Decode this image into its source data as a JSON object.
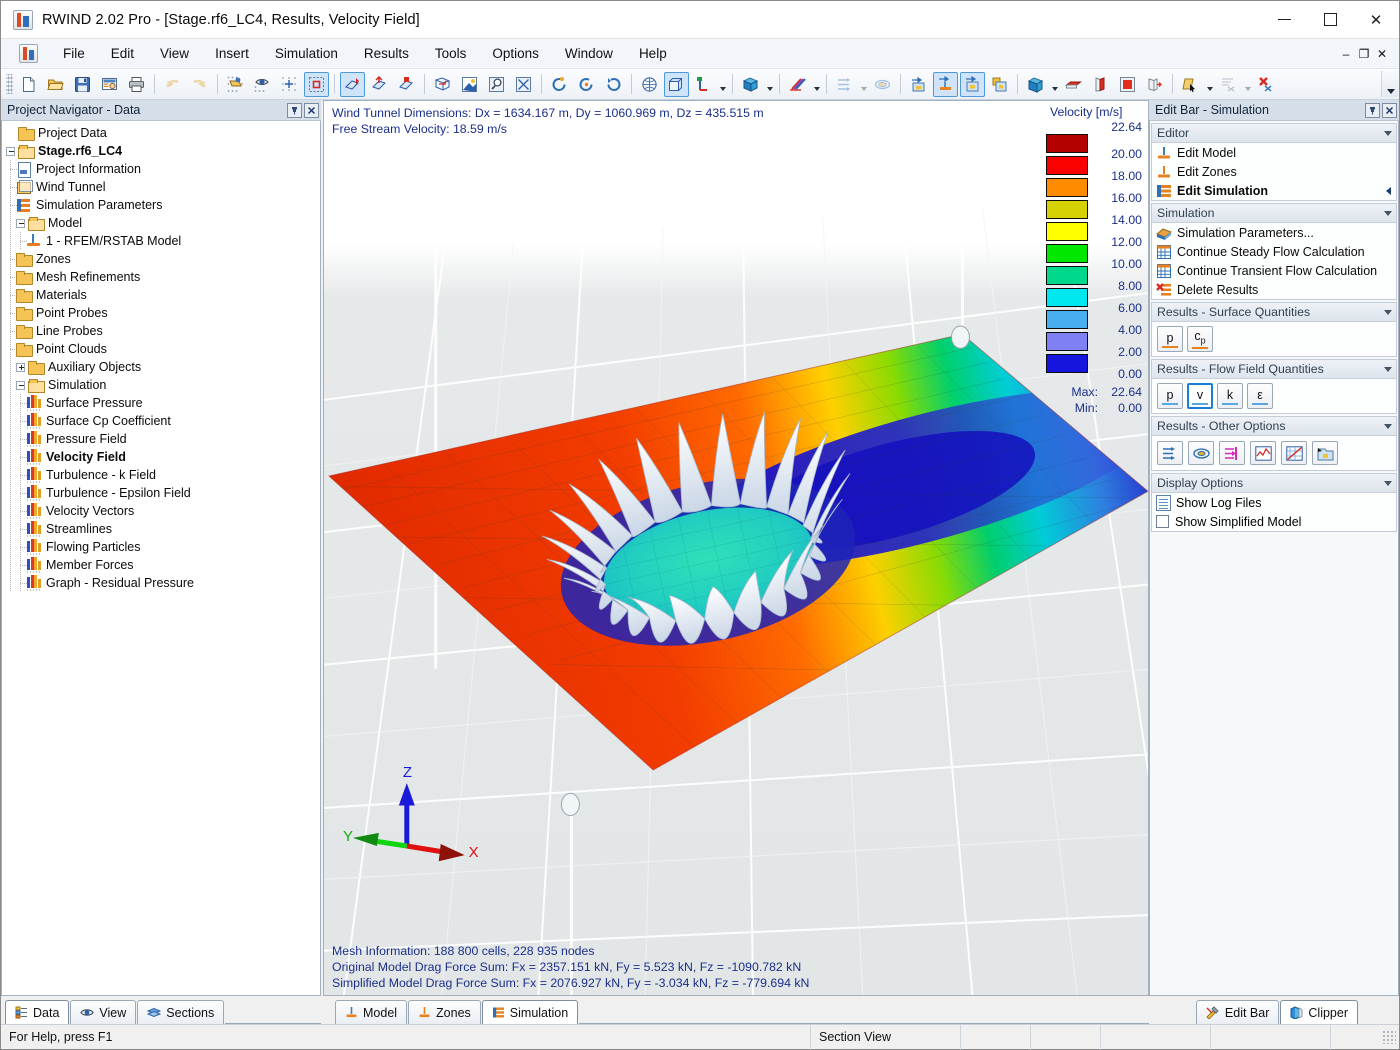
{
  "window": {
    "title": "RWIND 2.02 Pro - [Stage.rf6_LC4, Results, Velocity Field]",
    "app_icon": "rwind-icon",
    "minimize": "–",
    "maximize": "☐",
    "close": "✕"
  },
  "mdi_buttons": {
    "minimize": "–",
    "restore": "❐",
    "close": "✕"
  },
  "menu": {
    "items": [
      {
        "label": "File"
      },
      {
        "label": "Edit"
      },
      {
        "label": "View"
      },
      {
        "label": "Insert"
      },
      {
        "label": "Simulation"
      },
      {
        "label": "Results"
      },
      {
        "label": "Tools"
      },
      {
        "label": "Options"
      },
      {
        "label": "Window"
      },
      {
        "label": "Help"
      }
    ]
  },
  "toolbar": {
    "groups": [
      {
        "buttons": [
          {
            "name": "new-file-icon",
            "state": "normal"
          },
          {
            "name": "open-file-icon",
            "state": "normal"
          },
          {
            "name": "save-icon",
            "state": "normal"
          },
          {
            "name": "project-info-icon",
            "state": "normal"
          },
          {
            "name": "print-icon",
            "state": "normal"
          }
        ]
      },
      {
        "buttons": [
          {
            "name": "undo-icon",
            "state": "disabled"
          },
          {
            "name": "redo-icon",
            "state": "disabled"
          }
        ]
      },
      {
        "buttons": [
          {
            "name": "select-all-icon",
            "state": "normal"
          },
          {
            "name": "select-visible-icon",
            "state": "normal"
          },
          {
            "name": "snap-grid-icon",
            "state": "normal"
          },
          {
            "name": "selection-box-icon",
            "state": "active"
          }
        ]
      },
      {
        "buttons": [
          {
            "name": "move-object-icon",
            "state": "active"
          },
          {
            "name": "rotate-object-icon",
            "state": "normal"
          },
          {
            "name": "scale-object-icon",
            "state": "normal"
          }
        ]
      },
      {
        "buttons": [
          {
            "name": "wireframe-view-icon",
            "state": "normal"
          },
          {
            "name": "render-view-icon",
            "state": "normal"
          },
          {
            "name": "zoom-window-icon",
            "state": "normal"
          },
          {
            "name": "zoom-area-icon",
            "state": "normal"
          },
          {
            "name": "zoom-fit-icon",
            "state": "normal"
          }
        ]
      },
      {
        "buttons": [
          {
            "name": "rotate-view-icon",
            "state": "normal"
          },
          {
            "name": "rotate-ccw-icon",
            "state": "normal"
          },
          {
            "name": "rotate-cw-icon",
            "state": "normal"
          }
        ]
      },
      {
        "buttons": [
          {
            "name": "isometric-view-icon",
            "state": "normal"
          },
          {
            "name": "perspective-view-icon",
            "state": "active"
          },
          {
            "name": "axis-view-icon",
            "state": "dropdown"
          }
        ]
      },
      {
        "buttons": [
          {
            "name": "render-mode-icon",
            "state": "dropdown"
          }
        ]
      },
      {
        "buttons": [
          {
            "name": "color-scale-icon",
            "state": "dropdown"
          }
        ]
      },
      {
        "buttons": [
          {
            "name": "flow-arrows-icon",
            "state": "dropdown-disabled"
          },
          {
            "name": "streamlines-icon",
            "state": "disabled"
          }
        ]
      },
      {
        "buttons": [
          {
            "name": "result-surface-icon",
            "state": "normal"
          },
          {
            "name": "result-model-icon",
            "state": "active"
          },
          {
            "name": "result-section-icon",
            "state": "active"
          },
          {
            "name": "result-texture-icon",
            "state": "normal"
          }
        ]
      },
      {
        "buttons": [
          {
            "name": "clip-box-icon",
            "state": "dropdown"
          },
          {
            "name": "clip-plane-x-icon",
            "state": "normal"
          },
          {
            "name": "clip-plane-y-icon",
            "state": "normal"
          },
          {
            "name": "clip-plane-z-icon",
            "state": "normal"
          },
          {
            "name": "clip-move-icon",
            "state": "normal"
          }
        ]
      },
      {
        "buttons": [
          {
            "name": "pick-section-icon",
            "state": "dropdown"
          },
          {
            "name": "cut-section-icon",
            "state": "dropdown-disabled"
          },
          {
            "name": "delete-section-icon",
            "state": "normal"
          }
        ]
      }
    ]
  },
  "navigator": {
    "title": "Project Navigator - Data",
    "pin_glyph": "Π",
    "close_glyph": "✕",
    "tree": [
      {
        "label": "Project Data",
        "depth": 0,
        "icon": "folder",
        "toggle": "none",
        "bold": false
      },
      {
        "label": "Stage.rf6_LC4",
        "depth": 0,
        "icon": "folderopen",
        "toggle": "minus",
        "bold": true
      },
      {
        "label": "Project Information",
        "depth": 1,
        "icon": "doc",
        "toggle": "none",
        "bold": false
      },
      {
        "label": "Wind Tunnel",
        "depth": 1,
        "icon": "cube",
        "toggle": "none",
        "bold": false
      },
      {
        "label": "Simulation Parameters",
        "depth": 1,
        "icon": "simparams",
        "toggle": "none",
        "bold": false
      },
      {
        "label": "Model",
        "depth": 1,
        "icon": "folderopen",
        "toggle": "minus",
        "bold": false
      },
      {
        "label": "1 - RFEM/RSTAB Model",
        "depth": 2,
        "icon": "model",
        "toggle": "none",
        "bold": false
      },
      {
        "label": "Zones",
        "depth": 1,
        "icon": "folder",
        "toggle": "none",
        "bold": false
      },
      {
        "label": "Mesh Refinements",
        "depth": 1,
        "icon": "folder",
        "toggle": "none",
        "bold": false
      },
      {
        "label": "Materials",
        "depth": 1,
        "icon": "folder",
        "toggle": "none",
        "bold": false
      },
      {
        "label": "Point Probes",
        "depth": 1,
        "icon": "folder",
        "toggle": "none",
        "bold": false
      },
      {
        "label": "Line Probes",
        "depth": 1,
        "icon": "folder",
        "toggle": "none",
        "bold": false
      },
      {
        "label": "Point Clouds",
        "depth": 1,
        "icon": "folder",
        "toggle": "none",
        "bold": false
      },
      {
        "label": "Auxiliary Objects",
        "depth": 1,
        "icon": "folder",
        "toggle": "plus",
        "bold": false
      },
      {
        "label": "Simulation",
        "depth": 1,
        "icon": "folderopen",
        "toggle": "minus",
        "bold": false
      },
      {
        "label": "Surface Pressure",
        "depth": 2,
        "icon": "result",
        "toggle": "none",
        "bold": false
      },
      {
        "label": "Surface Cp Coefficient",
        "depth": 2,
        "icon": "result",
        "toggle": "none",
        "bold": false
      },
      {
        "label": "Pressure Field",
        "depth": 2,
        "icon": "result",
        "toggle": "none",
        "bold": false
      },
      {
        "label": "Velocity Field",
        "depth": 2,
        "icon": "result",
        "toggle": "none",
        "bold": true
      },
      {
        "label": "Turbulence - k Field",
        "depth": 2,
        "icon": "result",
        "toggle": "none",
        "bold": false
      },
      {
        "label": "Turbulence - Epsilon Field",
        "depth": 2,
        "icon": "result",
        "toggle": "none",
        "bold": false
      },
      {
        "label": "Velocity Vectors",
        "depth": 2,
        "icon": "result",
        "toggle": "none",
        "bold": false
      },
      {
        "label": "Streamlines",
        "depth": 2,
        "icon": "result",
        "toggle": "none",
        "bold": false
      },
      {
        "label": "Flowing Particles",
        "depth": 2,
        "icon": "result",
        "toggle": "none",
        "bold": false
      },
      {
        "label": "Member Forces",
        "depth": 2,
        "icon": "result",
        "toggle": "none",
        "bold": false
      },
      {
        "label": "Graph - Residual Pressure",
        "depth": 2,
        "icon": "result",
        "toggle": "none",
        "bold": false
      }
    ],
    "tabs": [
      {
        "label": "Data",
        "icon": "data-tree-icon",
        "active": true
      },
      {
        "label": "View",
        "icon": "eye-icon",
        "active": false
      },
      {
        "label": "Sections",
        "icon": "layers-icon",
        "active": false
      }
    ]
  },
  "viewport": {
    "info_top": [
      "Wind Tunnel Dimensions: Dx = 1634.167 m, Dy = 1060.969 m, Dz = 435.515 m",
      "Free Stream Velocity: 18.59 m/s"
    ],
    "info_bottom": [
      "Mesh Information: 188 800 cells, 228 935 nodes",
      "Original Model Drag Force Sum: Fx = 2357.151 kN, Fy = 5.523 kN, Fz = -1090.782 kN",
      "Simplified Model Drag Force Sum: Fx = 2076.927 kN, Fy = -3.034 kN, Fz = -779.694 kN"
    ],
    "axes": {
      "x": "X",
      "y": "Y",
      "z": "Z"
    },
    "tabs": [
      {
        "label": "Model",
        "icon": "model-icon",
        "active": false
      },
      {
        "label": "Zones",
        "icon": "zones-icon",
        "active": false
      },
      {
        "label": "Simulation",
        "icon": "simulation-icon",
        "active": true
      }
    ]
  },
  "legend": {
    "title": "Velocity [m/s]",
    "values": [
      "22.64",
      "20.00",
      "18.00",
      "16.00",
      "14.00",
      "12.00",
      "10.00",
      "8.00",
      "6.00",
      "4.00",
      "2.00",
      "0.00"
    ],
    "colors": [
      "#b50000",
      "#fb0000",
      "#ff8c00",
      "#d6d100",
      "#ffff00",
      "#00e800",
      "#00d98c",
      "#00e8ef",
      "#49aeef",
      "#8080f5",
      "#1515dd"
    ],
    "max_label": "Max:",
    "max_value": "22.64",
    "min_label": "Min:",
    "min_value": "0.00"
  },
  "editbar": {
    "title": "Edit Bar - Simulation",
    "pin_glyph": "Π",
    "close_glyph": "✕",
    "groups": [
      {
        "title": "Editor",
        "type": "list",
        "items": [
          {
            "label": "Edit Model",
            "icon": "model-icon",
            "bold": false,
            "arrow": false
          },
          {
            "label": "Edit Zones",
            "icon": "zones-icon",
            "bold": false,
            "arrow": false
          },
          {
            "label": "Edit Simulation",
            "icon": "simulation-icon",
            "bold": true,
            "arrow": true
          }
        ]
      },
      {
        "title": "Simulation",
        "type": "list",
        "items": [
          {
            "label": "Simulation Parameters...",
            "icon": "sim-params-icon",
            "bold": false,
            "arrow": false
          },
          {
            "label": "Continue Steady Flow Calculation",
            "icon": "grid-calc-icon",
            "bold": false,
            "arrow": false
          },
          {
            "label": "Continue Transient Flow Calculation",
            "icon": "grid-calc-icon",
            "bold": false,
            "arrow": false
          },
          {
            "label": "Delete Results",
            "icon": "delete-results-icon",
            "bold": false,
            "arrow": false
          }
        ]
      },
      {
        "title": "Results - Surface Quantities",
        "type": "quantity-buttons",
        "buttons": [
          {
            "label": "p",
            "sub": "",
            "underline": "orange",
            "selected": false,
            "name": "surface-pressure-button"
          },
          {
            "label": "c",
            "sub": "p",
            "underline": "orange",
            "selected": false,
            "name": "surface-cp-button"
          }
        ]
      },
      {
        "title": "Results - Flow Field Quantities",
        "type": "quantity-buttons",
        "buttons": [
          {
            "label": "p",
            "sub": "",
            "underline": "blue",
            "selected": false,
            "name": "flow-pressure-button"
          },
          {
            "label": "v",
            "sub": "",
            "underline": "blue",
            "selected": true,
            "name": "flow-velocity-button"
          },
          {
            "label": "k",
            "sub": "",
            "underline": "blue",
            "selected": false,
            "name": "flow-k-button"
          },
          {
            "label": "ε",
            "sub": "",
            "underline": "blue",
            "selected": false,
            "name": "flow-epsilon-button"
          }
        ]
      },
      {
        "title": "Results - Other Options",
        "type": "icon-buttons",
        "buttons": [
          {
            "name": "velocity-vectors-button"
          },
          {
            "name": "streamlines-button"
          },
          {
            "name": "flowing-particles-button"
          },
          {
            "name": "residual-graph-button"
          },
          {
            "name": "diagram-button"
          },
          {
            "name": "member-forces-button"
          }
        ]
      },
      {
        "title": "Display Options",
        "type": "checks",
        "items": [
          {
            "label": "Show Log Files",
            "kind": "doc",
            "checked": false,
            "name": "show-log-files"
          },
          {
            "label": "Show Simplified Model",
            "kind": "check",
            "checked": false,
            "name": "show-simplified-model"
          }
        ]
      }
    ],
    "tabs": [
      {
        "label": "Edit Bar",
        "icon": "tools-icon",
        "active": false
      },
      {
        "label": "Clipper",
        "icon": "clipper-icon",
        "active": true
      }
    ]
  },
  "statusbar": {
    "help": "For Help, press F1",
    "cells": [
      "",
      "Section View",
      "",
      "",
      "",
      "",
      ""
    ]
  }
}
